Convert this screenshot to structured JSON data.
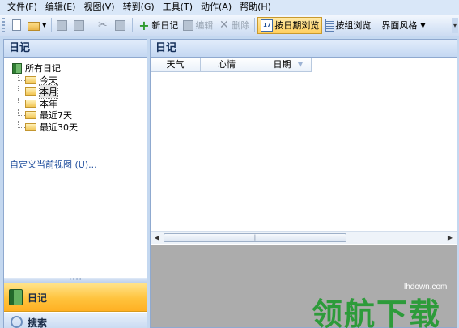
{
  "menubar": {
    "items": [
      "文件(F)",
      "编辑(E)",
      "视图(V)",
      "转到(G)",
      "工具(T)",
      "动作(A)",
      "帮助(H)"
    ]
  },
  "toolbar": {
    "new_diary": "新日记",
    "edit": "编辑",
    "delete": "删除",
    "browse_by_date": "按日期浏览",
    "browse_by_group": "按组浏览",
    "ui_style": "界面风格",
    "cal_icon_text": "17"
  },
  "left_panel": {
    "title": "日记",
    "tree": {
      "root": "所有日记",
      "children": [
        "今天",
        "本月",
        "本年",
        "最近7天",
        "最近30天"
      ]
    },
    "custom_view_link": "自定义当前视图 (U)...",
    "nav": {
      "diary": "日记",
      "search": "搜索"
    }
  },
  "right_panel": {
    "title": "日记",
    "columns": [
      "天气",
      "心情",
      "日期"
    ]
  },
  "watermark": {
    "url": "lhdown.com",
    "text": "领航下载"
  },
  "colors": {
    "accent_orange": "#ffc33d",
    "header_blue": "#c4d8f2",
    "watermark_green": "#2d9b3a"
  }
}
